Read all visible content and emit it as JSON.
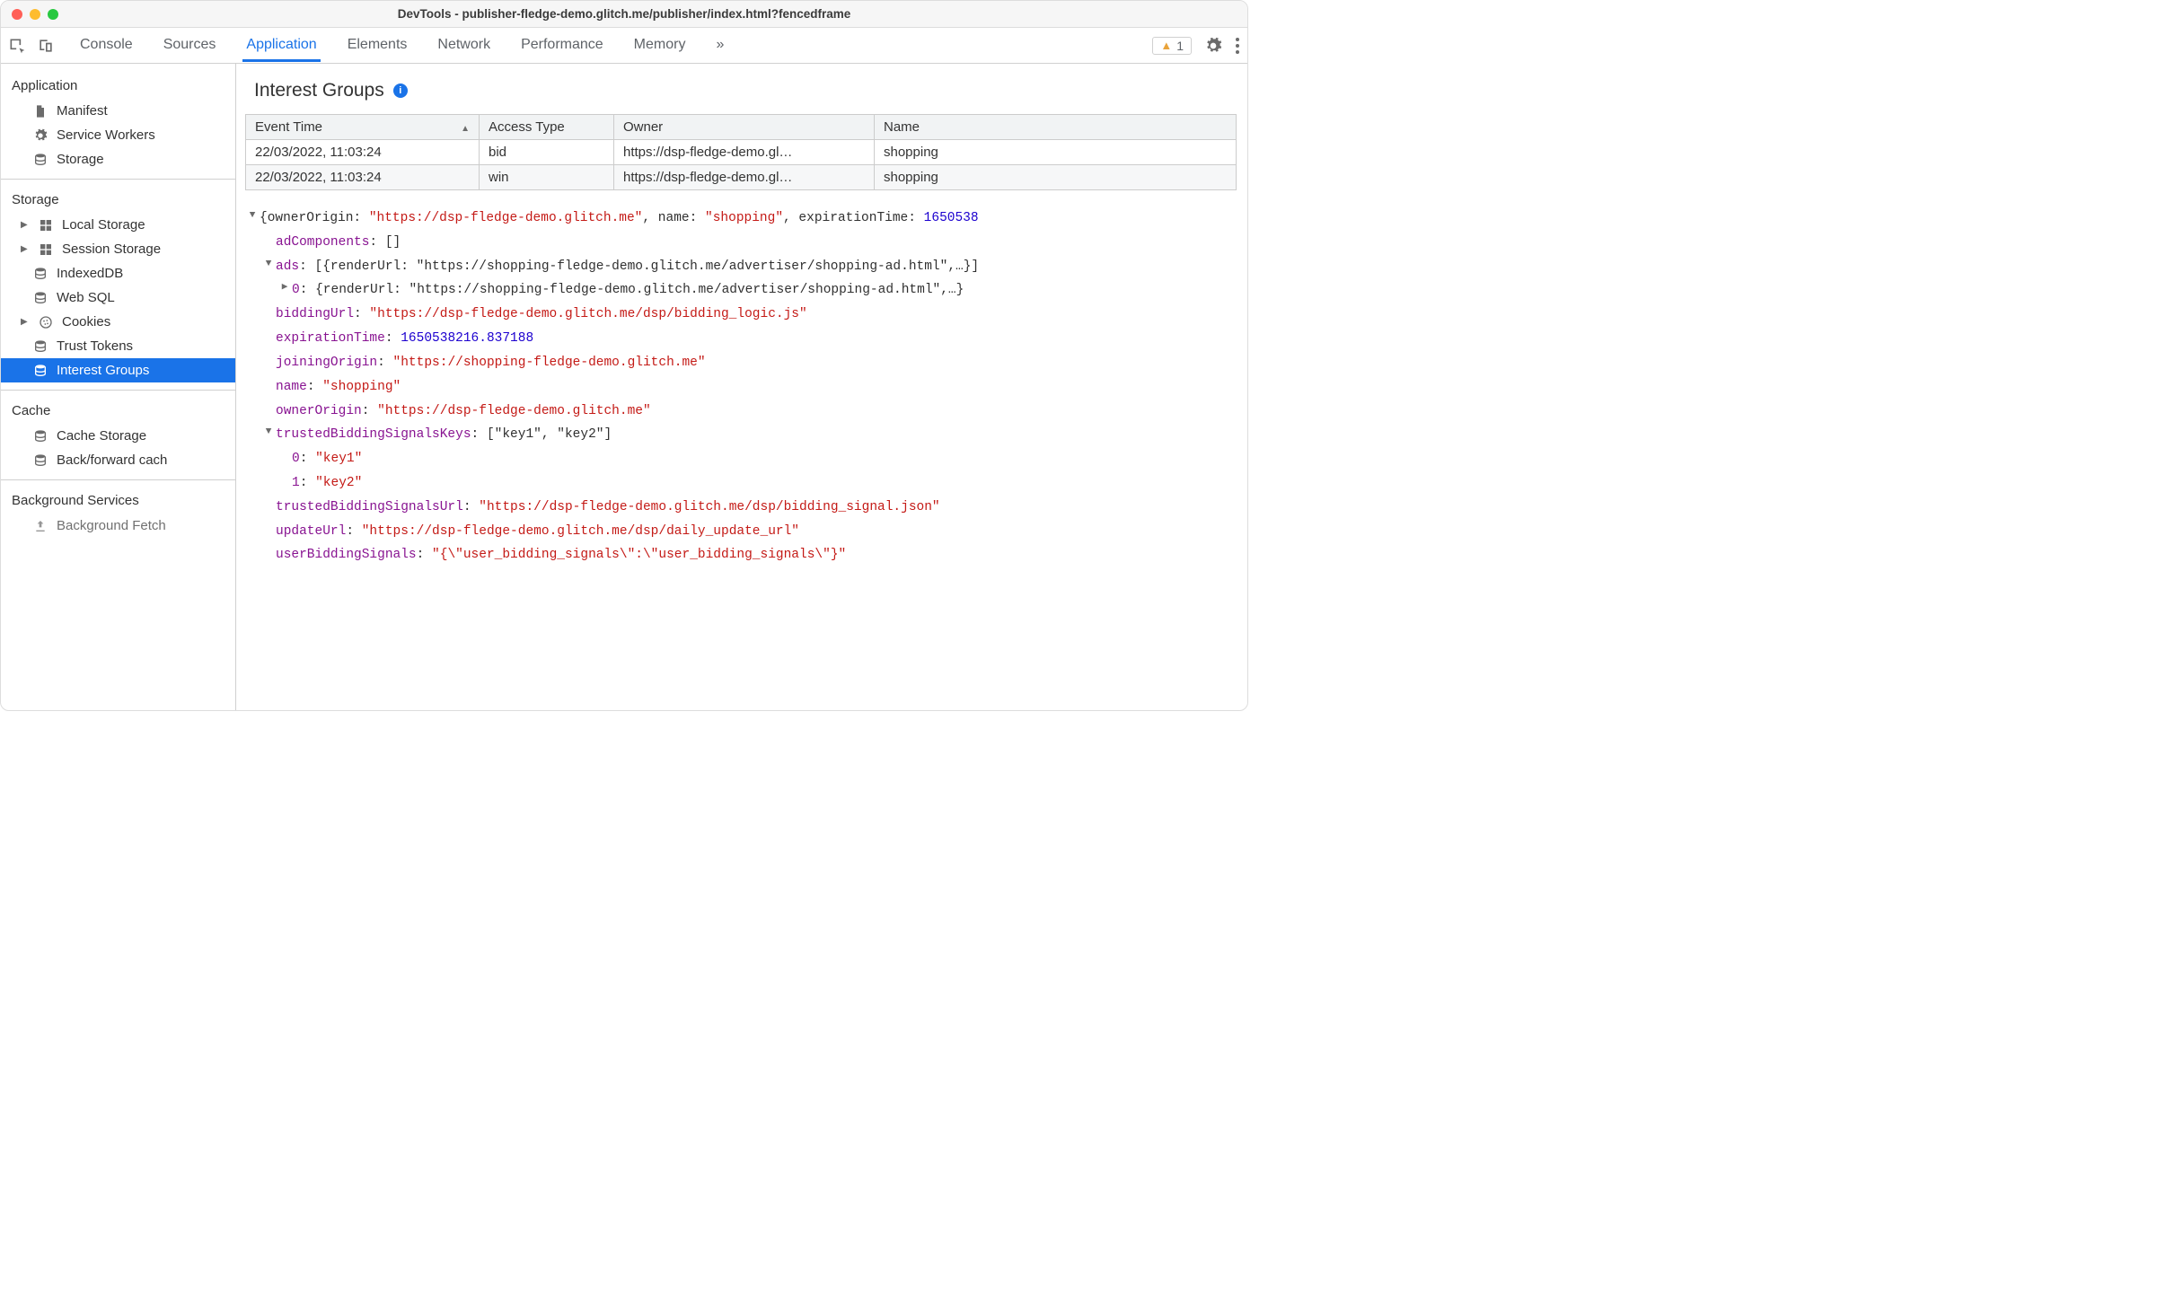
{
  "window": {
    "title": "DevTools - publisher-fledge-demo.glitch.me/publisher/index.html?fencedframe"
  },
  "tabs": {
    "items": [
      "Console",
      "Sources",
      "Application",
      "Elements",
      "Network",
      "Performance",
      "Memory"
    ],
    "active": 2,
    "more": "»",
    "warning_count": "1"
  },
  "sidebar": {
    "app_header": "Application",
    "app_items": [
      {
        "label": "Manifest",
        "icon": "file"
      },
      {
        "label": "Service Workers",
        "icon": "gear"
      },
      {
        "label": "Storage",
        "icon": "db"
      }
    ],
    "storage_header": "Storage",
    "storage_items": [
      {
        "label": "Local Storage",
        "icon": "grid",
        "expandable": true
      },
      {
        "label": "Session Storage",
        "icon": "grid",
        "expandable": true
      },
      {
        "label": "IndexedDB",
        "icon": "db",
        "expandable": false
      },
      {
        "label": "Web SQL",
        "icon": "db",
        "expandable": false
      },
      {
        "label": "Cookies",
        "icon": "cookie",
        "expandable": true
      },
      {
        "label": "Trust Tokens",
        "icon": "db",
        "expandable": false
      },
      {
        "label": "Interest Groups",
        "icon": "db",
        "expandable": false,
        "selected": true
      }
    ],
    "cache_header": "Cache",
    "cache_items": [
      {
        "label": "Cache Storage",
        "icon": "db"
      },
      {
        "label": "Back/forward cache",
        "icon": "db",
        "truncated": "Back/forward cach"
      }
    ],
    "bg_header": "Background Services",
    "bg_items": [
      {
        "label": "Background Fetch",
        "icon": "upload",
        "truncated": "Background Fetch"
      }
    ]
  },
  "main": {
    "heading": "Interest Groups",
    "columns": [
      "Event Time",
      "Access Type",
      "Owner",
      "Name"
    ],
    "rows": [
      {
        "time": "22/03/2022, 11:03:24",
        "type": "bid",
        "owner": "https://dsp-fledge-demo.gl…",
        "name": "shopping"
      },
      {
        "time": "22/03/2022, 11:03:24",
        "type": "win",
        "owner": "https://dsp-fledge-demo.gl…",
        "name": "shopping"
      }
    ]
  },
  "detail": {
    "topline_prefix": "{ownerOrigin: ",
    "topline_owner": "\"https://dsp-fledge-demo.glitch.me\"",
    "topline_mid": ", name: ",
    "topline_name": "\"shopping\"",
    "topline_mid2": ", expirationTime: ",
    "topline_exp": "1650538",
    "adComponents": "[]",
    "ads_line": "[{renderUrl: \"https://shopping-fledge-demo.glitch.me/advertiser/shopping-ad.html\",…}]",
    "ads0": "{renderUrl: \"https://shopping-fledge-demo.glitch.me/advertiser/shopping-ad.html\",…}",
    "biddingUrl": "\"https://dsp-fledge-demo.glitch.me/dsp/bidding_logic.js\"",
    "expirationTime": "1650538216.837188",
    "joiningOrigin": "\"https://shopping-fledge-demo.glitch.me\"",
    "name": "\"shopping\"",
    "ownerOrigin": "\"https://dsp-fledge-demo.glitch.me\"",
    "tbsk": "[\"key1\", \"key2\"]",
    "tbsk0": "\"key1\"",
    "tbsk1": "\"key2\"",
    "trustedBiddingSignalsUrl": "\"https://dsp-fledge-demo.glitch.me/dsp/bidding_signal.json\"",
    "updateUrl": "\"https://dsp-fledge-demo.glitch.me/dsp/daily_update_url\"",
    "userBiddingSignals": "\"{\\\"user_bidding_signals\\\":\\\"user_bidding_signals\\\"}\""
  }
}
